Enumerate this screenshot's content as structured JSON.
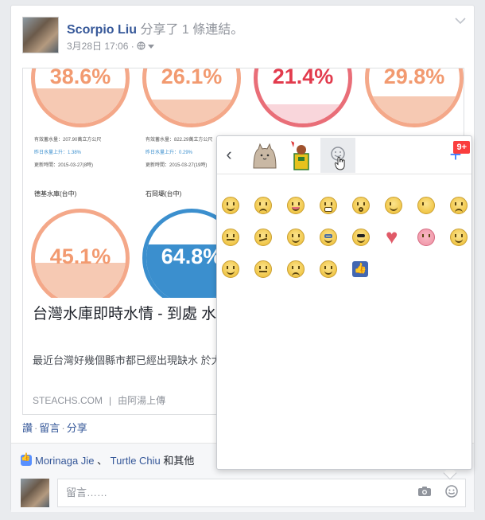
{
  "post": {
    "author": "Scorpio Liu",
    "action": " 分享了 1 條連結。",
    "date": "3月28日 17:06 · ",
    "privacy_icon": "globe-icon"
  },
  "link_image": {
    "gauges": [
      {
        "pct": "38.6%",
        "fill": 0.386,
        "style": "orange"
      },
      {
        "pct": "26.1%",
        "fill": 0.261,
        "style": "orange"
      },
      {
        "pct": "21.4%",
        "fill": 0.214,
        "style": "red"
      },
      {
        "pct": "29.8%",
        "fill": 0.298,
        "style": "orange"
      },
      {
        "pct": "45.1%",
        "fill": 0.451,
        "style": "orange"
      },
      {
        "pct": "64.8%",
        "fill": 0.648,
        "style": "blue"
      }
    ],
    "small_text": {
      "a1": "有效蓄水量：207.90萬立方公尺",
      "a2": "昨日水量上升：1.38%",
      "a3": "更新時間：2015-03-27(8時)",
      "b1": "有效蓄水量：822.29萬立方公尺",
      "b2": "昨日水量上升：0.29%",
      "b3": "更新時間：2015-03-27(19時)",
      "res1": "德基水庫(台中)",
      "res2": "石岡壩(台中)"
    }
  },
  "link": {
    "title": "台灣水庫即時水情 - 到處 水庫缺水嗎？ | 就是教不",
    "description": "最近台灣好幾個縣市都已經出現缺水 於大樓住戶較影響不大，畢竟大樓的",
    "source": "STEACHS.COM",
    "separator": "|",
    "uploader": "由阿湯上傳"
  },
  "actions": {
    "like": "讚",
    "comment": "留言",
    "share": "分享",
    "dot": "·"
  },
  "likes": {
    "user1": "Morinaga Jie",
    "sep": " 、 ",
    "user2": "Turtle Chiu",
    "rest": " 和其他"
  },
  "comment": {
    "placeholder": "留言……"
  },
  "picker": {
    "back_label": "‹",
    "add_label": "+",
    "badge": "9+",
    "tabs": [
      "pusheen-sticker-pack",
      "character-sticker-pack",
      "emoticon-pack"
    ],
    "emoji_rows": [
      [
        "smile",
        "frown",
        "tongue",
        "grin",
        "gasp",
        "wink",
        "pacman",
        "angry"
      ],
      [
        "squint",
        "unsure",
        "happy",
        "glasses",
        "sunglasses",
        "heart",
        "pig",
        "angel"
      ],
      [
        "smirk",
        "confused",
        "cry",
        "kiki",
        "like"
      ]
    ]
  }
}
